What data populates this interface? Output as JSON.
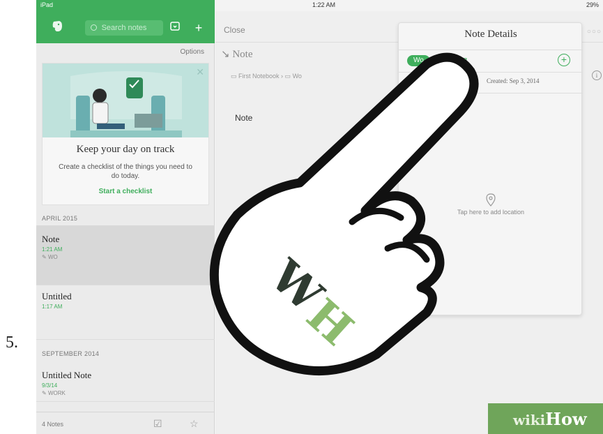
{
  "step": {
    "number": "5."
  },
  "status_bar": {
    "carrier": "iPad",
    "time": "1:22 AM",
    "battery": "29%"
  },
  "sidebar": {
    "search_placeholder": "Search notes",
    "options_label": "Options",
    "promo": {
      "title": "Keep your day on track",
      "body": "Create a checklist of the things you need to do today.",
      "link": "Start a checklist"
    },
    "sections": [
      {
        "header": "APRIL 2015",
        "notes": [
          {
            "title": "Note",
            "time": "1:21 AM",
            "tag": "WO"
          },
          {
            "title": "Untitled",
            "time": "1:17 AM"
          }
        ]
      },
      {
        "header": "SEPTEMBER 2014",
        "notes": [
          {
            "title": "Untitled Note",
            "time": "9/3/14",
            "tag": "WORK"
          }
        ]
      }
    ],
    "footer": {
      "count": "4 Notes"
    }
  },
  "editor": {
    "close_label": "Close",
    "note_heading": "Note",
    "notebook": "First Notebook",
    "tag": "Wo",
    "body_text": "Note"
  },
  "note_details": {
    "title": "Note Details",
    "tag_chip": "Wo",
    "add_tag_label": "Add Tag",
    "created": "Created: Sep 3, 2014",
    "location_prompt": "Tap here to add location"
  },
  "colors": {
    "accent": "#3fae5c",
    "watermark_green": "#6fa55a"
  },
  "watermark": {
    "prefix": "wiki",
    "suffix": "How",
    "badge_letters": [
      "W",
      "H"
    ]
  }
}
